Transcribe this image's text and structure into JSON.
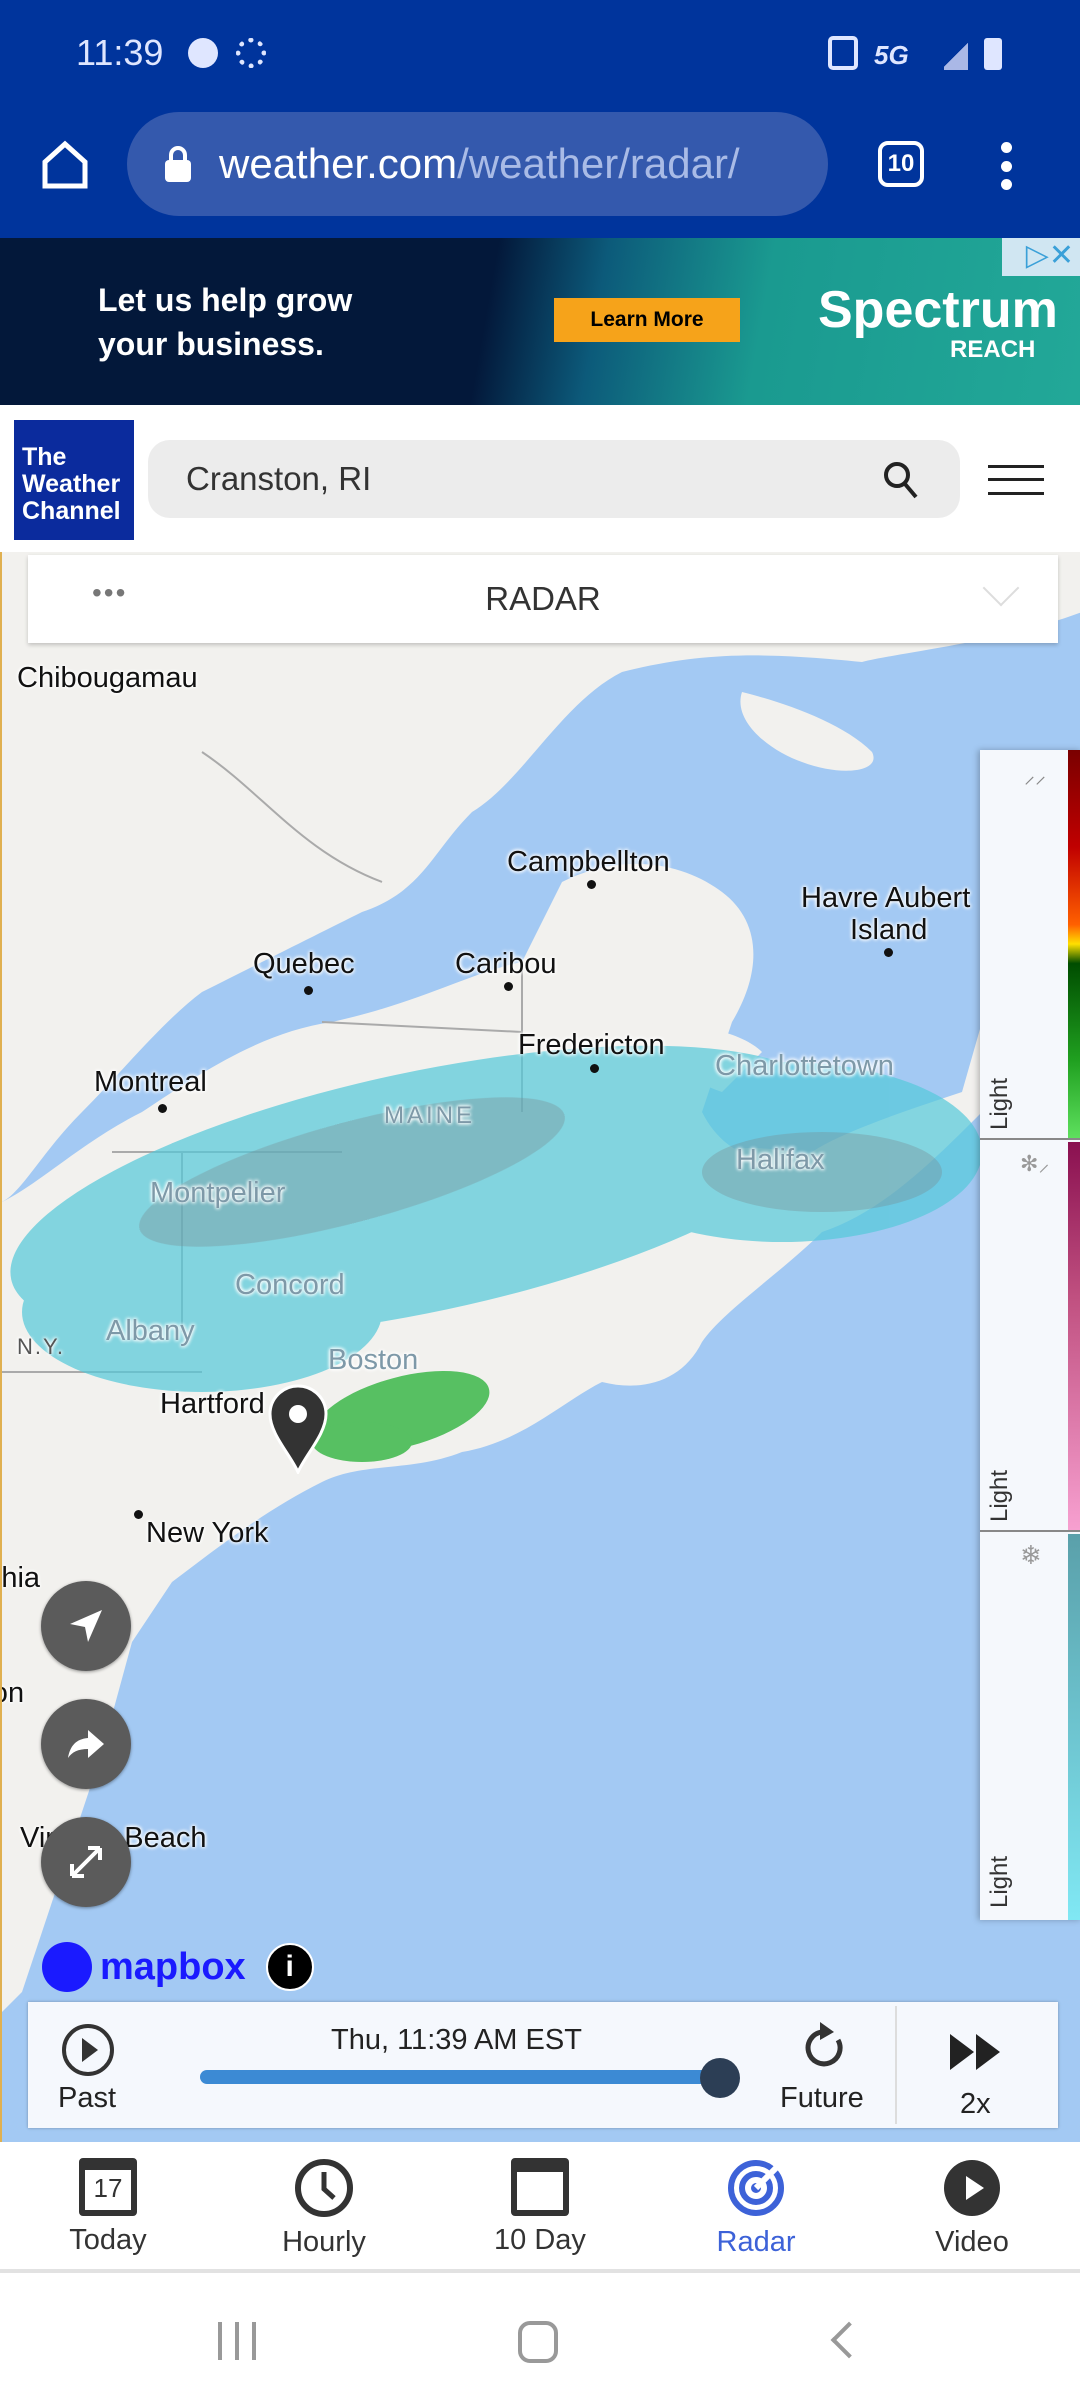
{
  "status_bar": {
    "time": "11:39",
    "icons": [
      "facebook-icon",
      "brightness-icon",
      "nfc-icon",
      "5g-icon",
      "signal-icon",
      "battery-icon"
    ],
    "network": "5G"
  },
  "browser": {
    "url_host": "weather.com",
    "url_path": "/weather/radar/",
    "tab_count": "10"
  },
  "ad": {
    "headline_1": "Let us help grow",
    "headline_2": "your business.",
    "cta": "Learn More",
    "brand": "Spectrum",
    "brand_sub": "REACH"
  },
  "header": {
    "logo_line1": "The",
    "logo_line2": "Weather",
    "logo_line3": "Channel",
    "search_value": "Cranston, RI"
  },
  "map": {
    "layer_title": "RADAR",
    "cities": [
      {
        "name": "Chibougamau"
      },
      {
        "name": "Campbellton"
      },
      {
        "name": "Havre Aubert"
      },
      {
        "name": "Island"
      },
      {
        "name": "Quebec"
      },
      {
        "name": "Caribou"
      },
      {
        "name": "Fredericton"
      },
      {
        "name": "Charlottetown"
      },
      {
        "name": "Montreal"
      },
      {
        "name": "MAINE"
      },
      {
        "name": "Halifax"
      },
      {
        "name": "Montpelier"
      },
      {
        "name": "Concord"
      },
      {
        "name": "Albany"
      },
      {
        "name": "N.Y."
      },
      {
        "name": "Boston"
      },
      {
        "name": "Hartford"
      },
      {
        "name": "New York"
      },
      {
        "name": "Virginia Beach"
      },
      {
        "name": "Philadelphia"
      },
      {
        "name": "Washington"
      }
    ],
    "legend": [
      {
        "type": "rain",
        "label": "Light"
      },
      {
        "type": "mix",
        "label": "Light"
      },
      {
        "type": "snow",
        "label": "Light"
      }
    ],
    "attribution": "mapbox"
  },
  "timeline": {
    "time": "Thu, 11:39 AM EST",
    "past": "Past",
    "future": "Future",
    "speed": "2x",
    "progress": 1.0
  },
  "nav": {
    "today_date": "17",
    "items": [
      {
        "label": "Today"
      },
      {
        "label": "Hourly"
      },
      {
        "label": "10 Day"
      },
      {
        "label": "Radar"
      },
      {
        "label": "Video"
      }
    ],
    "active": "Radar",
    "active_color": "#3d62d8"
  }
}
